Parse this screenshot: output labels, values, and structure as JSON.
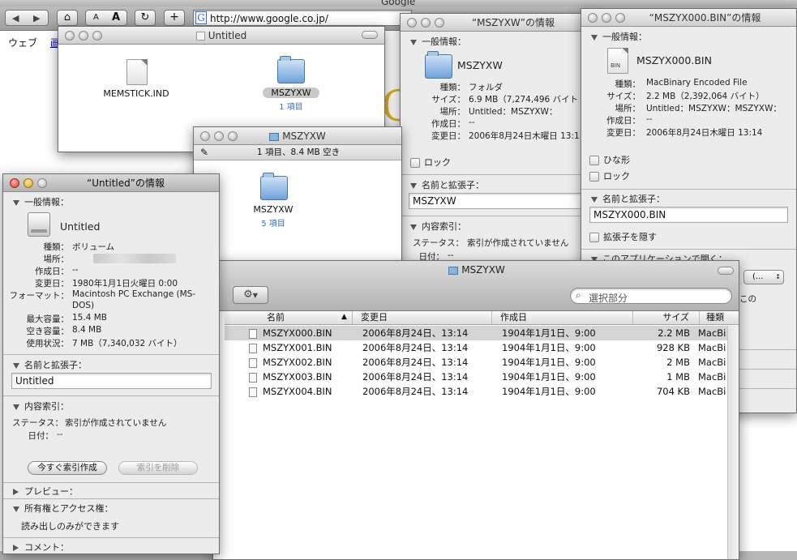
{
  "browser": {
    "title": "Google",
    "url": "http://www.google.co.jp/",
    "tab_web": "ウェブ",
    "tab_images": "画",
    "logo_letter": "G"
  },
  "untitled_window": {
    "title": "Untitled",
    "items": [
      {
        "name": "MEMSTICK.IND",
        "sub": ""
      },
      {
        "name": "MSZYXW",
        "sub": "1 項目"
      }
    ]
  },
  "mszyxw_small_window": {
    "title": "MSZYXW",
    "status": "1 項目、8.4 MB 空き",
    "item_name": "MSZYXW",
    "item_sub": "5 項目"
  },
  "info_untitled": {
    "title": "“Untitled”の情報",
    "general_header": "一般情報：",
    "name": "Untitled",
    "rows": [
      {
        "label": "種類：",
        "value": "ボリューム"
      },
      {
        "label": "場所：",
        "value": ""
      },
      {
        "label": "作成日：",
        "value": "--"
      },
      {
        "label": "変更日：",
        "value": "1980年1月1日火曜日 0:00"
      },
      {
        "label": "フォーマット：",
        "value": "Macintosh PC Exchange (MS-"
      },
      {
        "label": "",
        "value": "DOS)"
      },
      {
        "label": "最大容量：",
        "value": "15.4 MB"
      },
      {
        "label": "空き容量：",
        "value": "8.4 MB"
      },
      {
        "label": "使用状況：",
        "value": "7 MB（7,340,032 バイト）"
      }
    ],
    "name_ext_header": "名前と拡張子：",
    "name_field": "Untitled",
    "content_index_header": "内容索引：",
    "status_label": "ステータス：",
    "status_value": "索引が作成されていません",
    "date_label": "日付：",
    "date_value": "--",
    "btn_index_now": "今すぐ索引作成",
    "btn_delete_index": "索引を削除",
    "preview_header": "プレビュー：",
    "ownership_header": "所有権とアクセス権：",
    "ownership_value": "読み出しのみができます",
    "comments_header": "コメント："
  },
  "info_mszyxw": {
    "title": "“MSZYXW”の情報",
    "general_header": "一般情報：",
    "name": "MSZYXW",
    "rows": [
      {
        "label": "種類：",
        "value": "フォルダ"
      },
      {
        "label": "サイズ：",
        "value": "6.9 MB（7,274,496 バイト"
      },
      {
        "label": "場所：",
        "value": "Untitled：MSZYXW："
      },
      {
        "label": "作成日：",
        "value": "--"
      },
      {
        "label": "変更日：",
        "value": "2006年8月24日木曜日 13:1"
      }
    ],
    "lock_label": "ロック",
    "name_ext_header": "名前と拡張子：",
    "name_field": "MSZYXW",
    "content_index_header": "内容索引：",
    "status_label": "ステータス：",
    "status_value": "索引が作成されていません",
    "date_label": "日付：",
    "date_value": "--"
  },
  "info_bin": {
    "title": "“MSZYX000.BIN”の情報",
    "general_header": "一般情報：",
    "name": "MSZYX000.BIN",
    "icon_badge": "BIN",
    "rows": [
      {
        "label": "種類：",
        "value": "MacBinary Encoded File"
      },
      {
        "label": "サイズ：",
        "value": "2.2 MB（2,392,064 バイト）"
      },
      {
        "label": "場所：",
        "value": "Untitled：MSZYXW：MSZYXW："
      },
      {
        "label": "作成日：",
        "value": "--"
      },
      {
        "label": "変更日：",
        "value": "2006年8月24日木曜日 13:14"
      }
    ],
    "stationery_label": "ひな形",
    "lock_label": "ロック",
    "name_ext_header": "名前と拡張子：",
    "name_field": "MSZYX000.BIN",
    "hide_ext_label": "拡張子を隠す",
    "open_with_header": "このアプリケーションで開く：",
    "open_with_value": "(...",
    "partial_text": "この"
  },
  "finder_list": {
    "title": "MSZYXW",
    "search_placeholder": "選択部分",
    "columns": [
      "名前",
      "変更日",
      "作成日",
      "サイズ",
      "種類"
    ],
    "rows": [
      {
        "name": "MSZYX000.BIN",
        "modified": "2006年8月24日、13:14",
        "created": "1904年1月1日、9:00",
        "size": "2.2 MB",
        "kind": "MacBi"
      },
      {
        "name": "MSZYX001.BIN",
        "modified": "2006年8月24日、13:14",
        "created": "1904年1月1日、9:00",
        "size": "928 KB",
        "kind": "MacBi"
      },
      {
        "name": "MSZYX002.BIN",
        "modified": "2006年8月24日、13:14",
        "created": "1904年1月1日、9:00",
        "size": "2 MB",
        "kind": "MacBi"
      },
      {
        "name": "MSZYX003.BIN",
        "modified": "2006年8月24日、13:14",
        "created": "1904年1月1日、9:00",
        "size": "1 MB",
        "kind": "MacBi"
      },
      {
        "name": "MSZYX004.BIN",
        "modified": "2006年8月24日、13:14",
        "created": "1904年1月1日、9:00",
        "size": "704 KB",
        "kind": "MacBi"
      }
    ]
  }
}
